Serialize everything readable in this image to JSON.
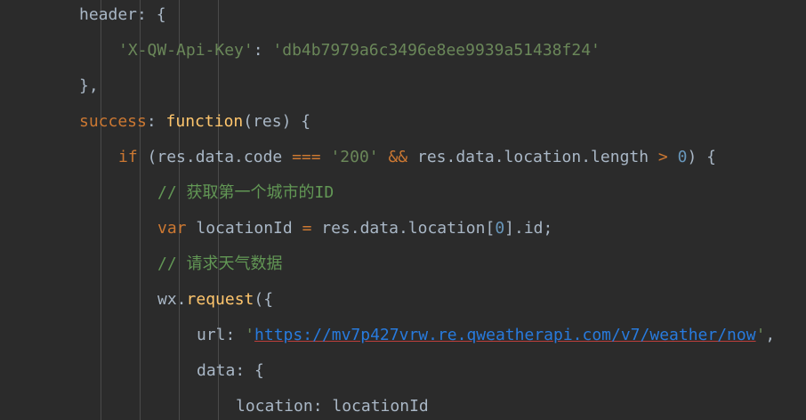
{
  "editor": {
    "lines": [
      {
        "indent": 89,
        "tokens": [
          {
            "t": "header",
            "c": "prop"
          },
          {
            "t": ": {",
            "c": "plain"
          }
        ]
      },
      {
        "indent": 133,
        "tokens": [
          {
            "t": "'X-QW-Api-Key'",
            "c": "str"
          },
          {
            "t": ": ",
            "c": "plain"
          },
          {
            "t": "'db4b7979a6c3496e8ee9939a51438f24'",
            "c": "str"
          }
        ]
      },
      {
        "indent": 89,
        "tokens": [
          {
            "t": "},",
            "c": "plain"
          }
        ]
      },
      {
        "indent": 89,
        "tokens": [
          {
            "t": "success",
            "c": "kw"
          },
          {
            "t": ": ",
            "c": "plain"
          },
          {
            "t": "function",
            "c": "fn"
          },
          {
            "t": "(",
            "c": "plain"
          },
          {
            "t": "res",
            "c": "param"
          },
          {
            "t": ") {",
            "c": "plain"
          }
        ]
      },
      {
        "indent": 133,
        "tokens": [
          {
            "t": "if",
            "c": "kw"
          },
          {
            "t": " (res.data.code ",
            "c": "plain"
          },
          {
            "t": "===",
            "c": "kw"
          },
          {
            "t": " ",
            "c": "plain"
          },
          {
            "t": "'200'",
            "c": "str"
          },
          {
            "t": " ",
            "c": "plain"
          },
          {
            "t": "&&",
            "c": "kw"
          },
          {
            "t": " res.data.location.length ",
            "c": "plain"
          },
          {
            "t": ">",
            "c": "kw"
          },
          {
            "t": " ",
            "c": "plain"
          },
          {
            "t": "0",
            "c": "num"
          },
          {
            "t": ") {",
            "c": "plain"
          }
        ]
      },
      {
        "indent": 177,
        "tokens": [
          {
            "t": "// 获取第一个城市的ID",
            "c": "cmt"
          }
        ]
      },
      {
        "indent": 177,
        "tokens": [
          {
            "t": "var",
            "c": "kw"
          },
          {
            "t": " locationId ",
            "c": "plain"
          },
          {
            "t": "=",
            "c": "kw"
          },
          {
            "t": " res.data.location[",
            "c": "plain"
          },
          {
            "t": "0",
            "c": "num"
          },
          {
            "t": "].id;",
            "c": "plain"
          }
        ]
      },
      {
        "indent": 177,
        "tokens": [
          {
            "t": "// 请求天气数据",
            "c": "cmt"
          }
        ]
      },
      {
        "indent": 177,
        "tokens": [
          {
            "t": "wx.",
            "c": "plain"
          },
          {
            "t": "request",
            "c": "method"
          },
          {
            "t": "({",
            "c": "plain"
          }
        ]
      },
      {
        "indent": 221,
        "tokens": [
          {
            "t": "url",
            "c": "prop"
          },
          {
            "t": ": ",
            "c": "plain"
          },
          {
            "t": "'",
            "c": "str"
          },
          {
            "t": "https://mv7p427vrw.re.qweatherapi.com/v7/weather/now",
            "c": "url"
          },
          {
            "t": "'",
            "c": "str"
          },
          {
            "t": ",",
            "c": "plain"
          }
        ]
      },
      {
        "indent": 221,
        "tokens": [
          {
            "t": "data",
            "c": "prop"
          },
          {
            "t": ": {",
            "c": "plain"
          }
        ]
      },
      {
        "indent": 265,
        "tokens": [
          {
            "t": "location",
            "c": "prop"
          },
          {
            "t": ": locationId",
            "c": "plain"
          }
        ]
      }
    ]
  },
  "colors": {
    "background": "#2b2b2b",
    "keyword": "#cc7832",
    "string": "#6a8759",
    "number": "#6897bb",
    "function": "#ffc66d",
    "comment": "#629755"
  }
}
